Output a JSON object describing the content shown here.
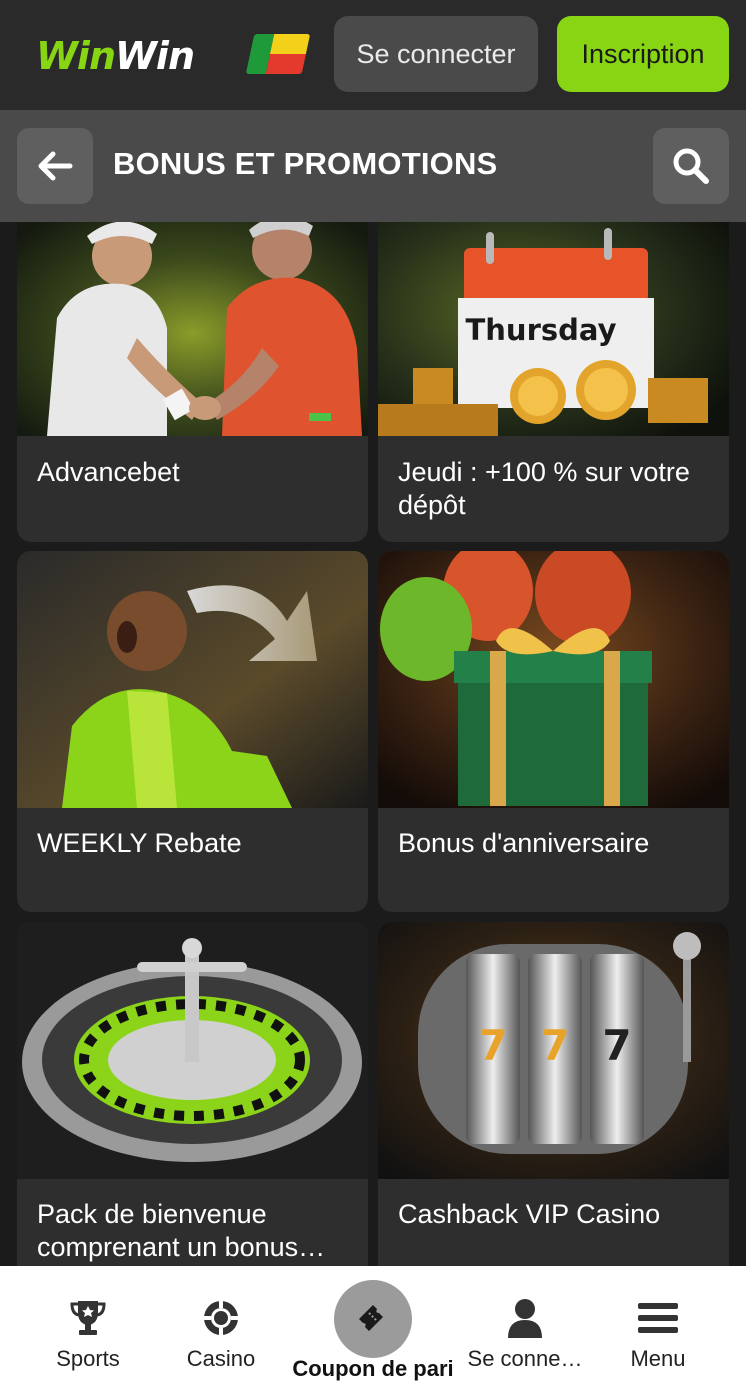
{
  "header": {
    "logo_part1": "Win",
    "logo_part2": "Win",
    "login_label": "Se connecter",
    "signup_label": "Inscription"
  },
  "page": {
    "title": "BONUS ET PROMOTIONS"
  },
  "promotions": [
    {
      "label": "Advancebet"
    },
    {
      "label": "Jeudi : +100 % sur votre dépôt",
      "image_text": "Thursday"
    },
    {
      "label": "WEEKLY Rebate"
    },
    {
      "label": "Bonus d'anniversaire"
    },
    {
      "label": "Pack de bienvenue comprenant un bonus…"
    },
    {
      "label": "Cashback VIP Casino"
    }
  ],
  "bottom_nav": {
    "sports": "Sports",
    "casino": "Casino",
    "coupon": "Coupon de pari",
    "account": "Se conne…",
    "menu": "Menu"
  },
  "colors": {
    "accent": "#88d514",
    "background": "#1b1b1b",
    "card": "#2e2e2e"
  }
}
